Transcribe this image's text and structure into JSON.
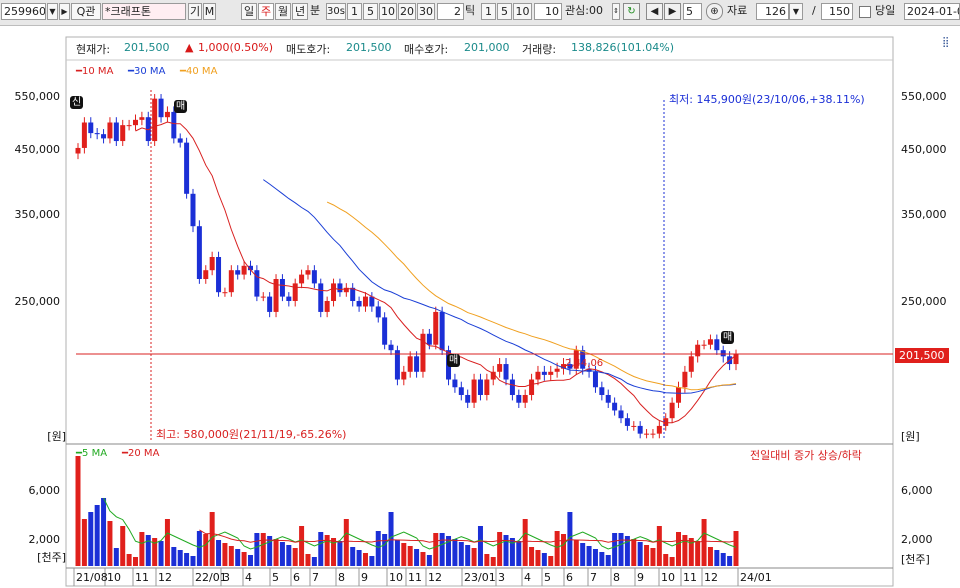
{
  "toolbar": {
    "code": "259960",
    "search_label": "Q관",
    "stock_name": "*크래프톤",
    "gi_label": "기",
    "m_label": "M",
    "period_day": "일",
    "period_week": "주",
    "period_month": "월",
    "period_year": "년",
    "period_minute": "분",
    "minute_val": "30s",
    "min_1": "1",
    "min_5": "5",
    "min_10": "10",
    "min_20": "20",
    "min_30": "30",
    "tick_val": "2",
    "tick_label": "틱",
    "tick_1": "1",
    "tick_5": "5",
    "tick_10": "10",
    "tick_input": "10",
    "interest_label": "관심:00",
    "step_val": "5",
    "data_label": "자료",
    "data_count": "126",
    "slash": "/",
    "total_count": "150",
    "today_label": "당일",
    "date": "2024-01-0"
  },
  "info": {
    "current_label": "현재가:",
    "current_value": "201,500",
    "change_value": "1,000(0.50%)",
    "ask_label": "매도호가:",
    "ask_value": "201,500",
    "bid_label": "매수호가:",
    "bid_value": "201,000",
    "volume_label": "거래량:",
    "volume_value": "138,826(101.04%)"
  },
  "legend": {
    "ma10": "10 MA",
    "ma30": "30 MA",
    "ma40": "40 MA",
    "vma5": "5 MA",
    "vma20": "20 MA",
    "vol_note": "전일대비 증가 상승/하락"
  },
  "annotations": {
    "low": "최저: 145,900원(23/10/06,+38.11%)",
    "high": "최고: 580,000원(21/11/19,-65.26%)",
    "mid_label": "2,44,06",
    "current_price_tag": "201,500",
    "badge_new": "신",
    "badge_1": "매",
    "badge_2": "매",
    "badge_3": "매"
  },
  "axis": {
    "price_unit": "[원]",
    "volume_unit": "[천주]",
    "price_ticks": [
      "550,000",
      "450,000",
      "350,000",
      "250,000"
    ],
    "volume_ticks": [
      "6,000",
      "2,000"
    ],
    "x_labels": [
      "21/08",
      "10",
      "11",
      "12",
      "22/01",
      "3",
      "4",
      "5",
      "6",
      "7",
      "8",
      "9",
      "10",
      "11",
      "12",
      "23/01",
      "3",
      "4",
      "5",
      "6",
      "7",
      "8",
      "9",
      "10",
      "11",
      "12",
      "24/01"
    ]
  },
  "colors": {
    "up": "#e0201c",
    "down": "#1b2fd6",
    "ma10": "#d82020",
    "ma30": "#1b3fd6",
    "ma40": "#f0a020",
    "vma5": "#22aa22",
    "vma20": "#d82020",
    "price_line": "#d82020"
  },
  "chart_data": {
    "type": "candlestick",
    "weekly_close": [
      452000,
      500000,
      480000,
      478000,
      470000,
      500000,
      465000,
      495000,
      495000,
      505000,
      510000,
      465000,
      545000,
      510000,
      520000,
      470000,
      462000,
      380000,
      335000,
      275000,
      285000,
      300000,
      260000,
      260000,
      285000,
      280000,
      290000,
      285000,
      255000,
      255000,
      240000,
      275000,
      255000,
      250000,
      270000,
      280000,
      285000,
      270000,
      240000,
      250000,
      270000,
      260000,
      265000,
      250000,
      245000,
      255000,
      245000,
      235000,
      210000,
      205000,
      185000,
      190000,
      200000,
      190000,
      220000,
      210000,
      240000,
      205000,
      185000,
      180000,
      175000,
      170000,
      185000,
      175000,
      185000,
      190000,
      195000,
      185000,
      175000,
      170000,
      175000,
      185000,
      190000,
      188000,
      190000,
      192000,
      195000,
      192000,
      205000,
      192000,
      190000,
      180000,
      175000,
      170000,
      165000,
      160000,
      155000,
      155000,
      150000,
      150000,
      150000,
      155000,
      160000,
      170000,
      180000,
      190000,
      200000,
      210000,
      210000,
      215000,
      205000,
      200000,
      195000,
      201500
    ]
  }
}
